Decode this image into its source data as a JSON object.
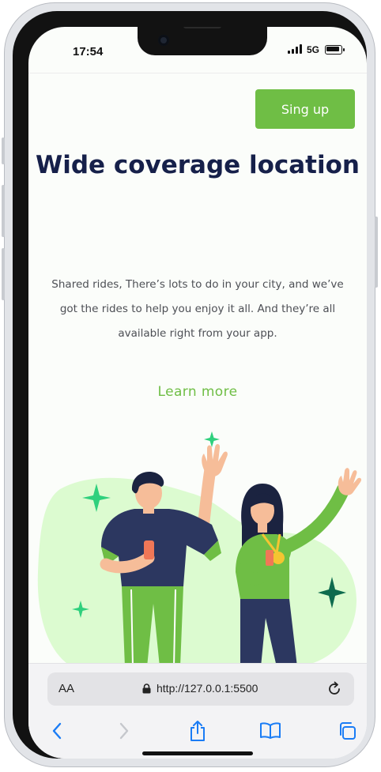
{
  "status": {
    "time": "17:54",
    "network": "5G"
  },
  "header": {
    "signup_label": "Sing up"
  },
  "hero": {
    "title": "Wide coverage location",
    "description": "Shared rides, There’s lots to do in your city, and we’ve got the rides to help you enjoy it all. And they’re all available right from your app.",
    "learn_more_label": "Learn more"
  },
  "browser": {
    "aa_label": "AA",
    "url": "http://127.0.0.1:5500",
    "icons": [
      "lock-icon",
      "reload-icon",
      "back-icon",
      "forward-icon",
      "share-icon",
      "bookmarks-icon",
      "tabs-icon"
    ]
  },
  "colors": {
    "accent": "#6fbe45",
    "title": "#16204a",
    "illustration_bg": "#dcfbd0",
    "shirt": "#2c3760",
    "sparkle_dark": "#0e6b4e",
    "sparkle_light": "#2fd07d",
    "ios_blue": "#1a7cf5"
  }
}
